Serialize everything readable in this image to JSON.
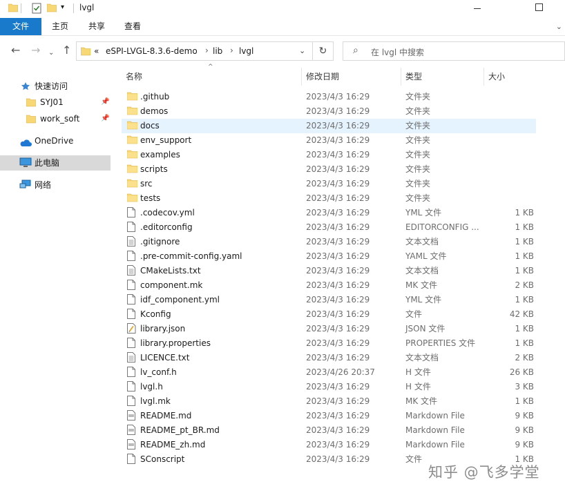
{
  "window": {
    "title": "lvgl"
  },
  "ribbon": {
    "tabs": [
      "文件",
      "主页",
      "共享",
      "查看"
    ]
  },
  "address": {
    "overflow": "«",
    "crumbs": [
      "eSPI-LVGL-8.3.6-demo",
      "lib",
      "lvgl"
    ],
    "separator": "›"
  },
  "search": {
    "placeholder": "在 lvgl 中搜索"
  },
  "nav_pane": {
    "items": [
      {
        "label": "快速访问",
        "icon": "star-icon"
      },
      {
        "label": "SYJ01",
        "icon": "folder-icon",
        "pinned": true
      },
      {
        "label": "work_soft",
        "icon": "folder-icon",
        "pinned": true
      },
      {
        "label": "OneDrive",
        "icon": "cloud-icon"
      },
      {
        "label": "此电脑",
        "icon": "computer-icon",
        "selected": true
      },
      {
        "label": "网络",
        "icon": "network-icon"
      }
    ]
  },
  "columns": {
    "name": "名称",
    "date": "修改日期",
    "type": "类型",
    "size": "大小"
  },
  "files": [
    {
      "name": ".github",
      "date": "2023/4/3 16:29",
      "type": "文件夹",
      "size": "",
      "icon": "folder-icon"
    },
    {
      "name": "demos",
      "date": "2023/4/3 16:29",
      "type": "文件夹",
      "size": "",
      "icon": "folder-icon"
    },
    {
      "name": "docs",
      "date": "2023/4/3 16:29",
      "type": "文件夹",
      "size": "",
      "icon": "folder-icon",
      "selected": true
    },
    {
      "name": "env_support",
      "date": "2023/4/3 16:29",
      "type": "文件夹",
      "size": "",
      "icon": "folder-icon"
    },
    {
      "name": "examples",
      "date": "2023/4/3 16:29",
      "type": "文件夹",
      "size": "",
      "icon": "folder-icon"
    },
    {
      "name": "scripts",
      "date": "2023/4/3 16:29",
      "type": "文件夹",
      "size": "",
      "icon": "folder-icon"
    },
    {
      "name": "src",
      "date": "2023/4/3 16:29",
      "type": "文件夹",
      "size": "",
      "icon": "folder-icon"
    },
    {
      "name": "tests",
      "date": "2023/4/3 16:29",
      "type": "文件夹",
      "size": "",
      "icon": "folder-icon"
    },
    {
      "name": ".codecov.yml",
      "date": "2023/4/3 16:29",
      "type": "YML 文件",
      "size": "1 KB",
      "icon": "file-icon"
    },
    {
      "name": ".editorconfig",
      "date": "2023/4/3 16:29",
      "type": "EDITORCONFIG ...",
      "size": "1 KB",
      "icon": "file-icon"
    },
    {
      "name": ".gitignore",
      "date": "2023/4/3 16:29",
      "type": "文本文档",
      "size": "1 KB",
      "icon": "text-file-icon"
    },
    {
      "name": ".pre-commit-config.yaml",
      "date": "2023/4/3 16:29",
      "type": "YAML 文件",
      "size": "1 KB",
      "icon": "file-icon"
    },
    {
      "name": "CMakeLists.txt",
      "date": "2023/4/3 16:29",
      "type": "文本文档",
      "size": "1 KB",
      "icon": "text-file-icon"
    },
    {
      "name": "component.mk",
      "date": "2023/4/3 16:29",
      "type": "MK 文件",
      "size": "2 KB",
      "icon": "file-icon"
    },
    {
      "name": "idf_component.yml",
      "date": "2023/4/3 16:29",
      "type": "YML 文件",
      "size": "1 KB",
      "icon": "file-icon"
    },
    {
      "name": "Kconfig",
      "date": "2023/4/3 16:29",
      "type": "文件",
      "size": "42 KB",
      "icon": "file-icon"
    },
    {
      "name": "library.json",
      "date": "2023/4/3 16:29",
      "type": "JSON 文件",
      "size": "1 KB",
      "icon": "json-file-icon"
    },
    {
      "name": "library.properties",
      "date": "2023/4/3 16:29",
      "type": "PROPERTIES 文件",
      "size": "1 KB",
      "icon": "file-icon"
    },
    {
      "name": "LICENCE.txt",
      "date": "2023/4/3 16:29",
      "type": "文本文档",
      "size": "2 KB",
      "icon": "text-file-icon"
    },
    {
      "name": "lv_conf.h",
      "date": "2023/4/26 20:37",
      "type": "H 文件",
      "size": "26 KB",
      "icon": "file-icon"
    },
    {
      "name": "lvgl.h",
      "date": "2023/4/3 16:29",
      "type": "H 文件",
      "size": "3 KB",
      "icon": "file-icon"
    },
    {
      "name": "lvgl.mk",
      "date": "2023/4/3 16:29",
      "type": "MK 文件",
      "size": "1 KB",
      "icon": "file-icon"
    },
    {
      "name": "README.md",
      "date": "2023/4/3 16:29",
      "type": "Markdown File",
      "size": "9 KB",
      "icon": "markdown-file-icon"
    },
    {
      "name": "README_pt_BR.md",
      "date": "2023/4/3 16:29",
      "type": "Markdown File",
      "size": "9 KB",
      "icon": "markdown-file-icon"
    },
    {
      "name": "README_zh.md",
      "date": "2023/4/3 16:29",
      "type": "Markdown File",
      "size": "9 KB",
      "icon": "markdown-file-icon"
    },
    {
      "name": "SConscript",
      "date": "2023/4/3 16:29",
      "type": "文件",
      "size": "1 KB",
      "icon": "file-icon"
    }
  ],
  "watermark": "知乎 @飞多学堂",
  "colors": {
    "accent": "#1979ca",
    "folder": "#f8d775",
    "selection": "#e5f3ff",
    "nav_selection": "#d9d9d9"
  }
}
